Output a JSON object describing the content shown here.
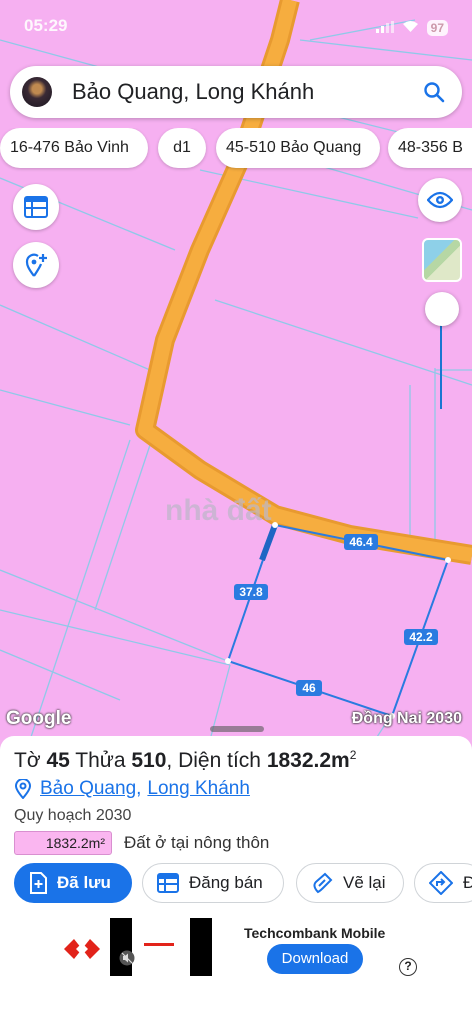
{
  "status_bar": {
    "time": "05:29",
    "battery": "97"
  },
  "search": {
    "query": "Bảo Quang, Long Khánh"
  },
  "chips": [
    "16-476 Bảo Vinh",
    "d1",
    "45-510 Bảo Quang",
    "48-356 B"
  ],
  "map": {
    "land_color": "#f6b0f1",
    "road_color": "#f3a53a",
    "parcel_color": "#2979d6",
    "edge_labels": [
      "46.4",
      "37.8",
      "42.2",
      "46"
    ],
    "watermark": "nhà đất",
    "google_label": "Google",
    "layer_label": "Đồng Nai 2030"
  },
  "parcel": {
    "title_prefix": "Tờ",
    "sheet_no": "45",
    "plot_prefix": "Thửa",
    "plot_no": "510",
    "area_prefix": ", Diện tích",
    "area_value": "1832.2m",
    "area_unit_sup": "2",
    "ward": "Bảo Quang",
    "city": "Long Khánh",
    "plan": "Quy hoạch 2030",
    "area_chip": "1832.2m²",
    "land_use": "Đất ở tại nông thôn"
  },
  "actions": [
    {
      "label": "Đã lưu",
      "icon": "save-plus-icon"
    },
    {
      "label": "Đăng bán",
      "icon": "listing-icon"
    },
    {
      "label": "Vẽ lại",
      "icon": "draw-icon"
    },
    {
      "label": "Đ",
      "icon": "directions-icon"
    }
  ],
  "ad": {
    "title": "Techcombank Mobile",
    "cta": "Download",
    "help": "?"
  }
}
